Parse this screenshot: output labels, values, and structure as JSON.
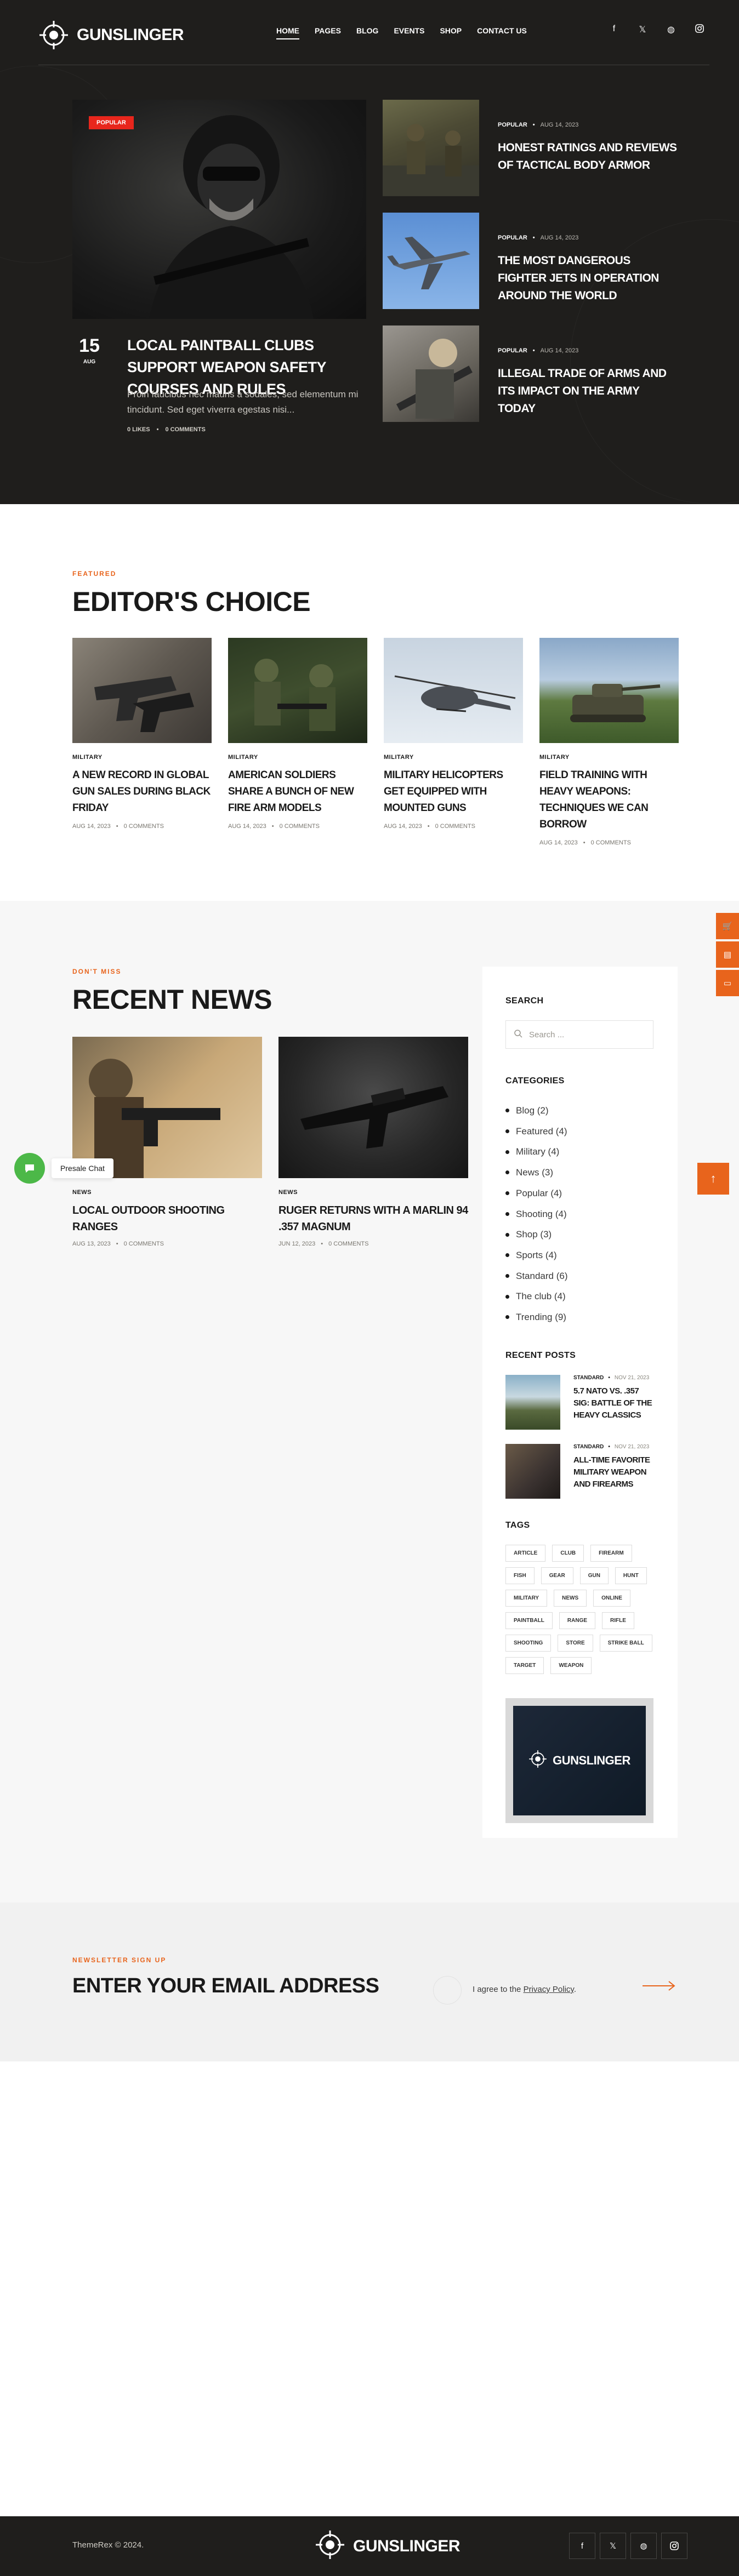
{
  "header": {
    "brand": "GUNSLINGER",
    "nav": [
      "HOME",
      "PAGES",
      "BLOG",
      "EVENTS",
      "SHOP",
      "CONTACT US"
    ],
    "social_icons": [
      "facebook-icon",
      "x-icon",
      "dribbble-icon",
      "instagram-icon"
    ]
  },
  "hero": {
    "main": {
      "badge": "POPULAR",
      "day": "15",
      "month": "AUG",
      "title": "LOCAL PAINTBALL CLUBS SUPPORT WEAPON SAFETY COURSES AND RULES",
      "excerpt": "Proin faucibus nec mauris a sodales, sed elementum mi tincidunt. Sed eget viverra egestas nisi...",
      "likes": "0 LIKES",
      "comments": "0 COMMENTS"
    },
    "side": [
      {
        "category": "POPULAR",
        "date": "AUG 14, 2023",
        "title": "HONEST RATINGS AND REVIEWS OF TACTICAL BODY ARMOR"
      },
      {
        "category": "POPULAR",
        "date": "AUG 14, 2023",
        "title": "THE MOST DANGEROUS FIGHTER JETS IN OPERATION AROUND THE WORLD"
      },
      {
        "category": "POPULAR",
        "date": "AUG 14, 2023",
        "title": "ILLEGAL TRADE OF ARMS AND ITS IMPACT ON THE ARMY TODAY"
      }
    ]
  },
  "editors": {
    "eyebrow": "FEATURED",
    "title": "EDITOR'S CHOICE",
    "cards": [
      {
        "category": "MILITARY",
        "title": "A NEW RECORD IN GLOBAL GUN SALES DURING BLACK FRIDAY",
        "date": "AUG 14, 2023",
        "comments": "0 COMMENTS"
      },
      {
        "category": "MILITARY",
        "title": "AMERICAN SOLDIERS SHARE A BUNCH OF NEW FIRE ARM MODELS",
        "date": "AUG 14, 2023",
        "comments": "0 COMMENTS"
      },
      {
        "category": "MILITARY",
        "title": "MILITARY HELICOPTERS GET EQUIPPED WITH MOUNTED GUNS",
        "date": "AUG 14, 2023",
        "comments": "0 COMMENTS"
      },
      {
        "category": "MILITARY",
        "title": "FIELD TRAINING WITH HEAVY WEAPONS: TECHNIQUES WE CAN BORROW",
        "date": "AUG 14, 2023",
        "comments": "0 COMMENTS"
      }
    ]
  },
  "recent": {
    "eyebrow": "DON'T MISS",
    "title": "RECENT NEWS",
    "cards": [
      {
        "category": "NEWS",
        "title": "LOCAL OUTDOOR SHOOTING RANGES",
        "date": "AUG 13, 2023",
        "comments": "0 COMMENTS"
      },
      {
        "category": "NEWS",
        "title": "RUGER RETURNS WITH A MARLIN 94 .357 MAGNUM",
        "date": "JUN 12, 2023",
        "comments": "0 COMMENTS"
      }
    ]
  },
  "sidebar": {
    "search_heading": "SEARCH",
    "search_placeholder": "Search ...",
    "categories_heading": "CATEGORIES",
    "categories": [
      "Blog (2)",
      "Featured (4)",
      "Military (4)",
      "News (3)",
      "Popular (4)",
      "Shooting (4)",
      "Shop (3)",
      "Sports (4)",
      "Standard (6)",
      "The club (4)",
      "Trending (9)"
    ],
    "recent_heading": "RECENT POSTS",
    "recent_posts": [
      {
        "category": "STANDARD",
        "date": "NOV 21, 2023",
        "title": "5.7 NATO VS. .357 SIG: BATTLE OF THE HEAVY CLASSICS"
      },
      {
        "category": "STANDARD",
        "date": "NOV 21, 2023",
        "title": "ALL-TIME FAVORITE MILITARY WEAPON AND FIREARMS"
      }
    ],
    "tags_heading": "TAGS",
    "tags": [
      "ARTICLE",
      "CLUB",
      "FIREARM",
      "FISH",
      "GEAR",
      "GUN",
      "HUNT",
      "MILITARY",
      "NEWS",
      "ONLINE",
      "PAINTBALL",
      "RANGE",
      "RIFLE",
      "SHOOTING",
      "STORE",
      "STRIKE BALL",
      "TARGET",
      "WEAPON"
    ],
    "banner_brand": "GUNSLINGER"
  },
  "newsletter": {
    "eyebrow": "NEWSLETTER SIGN UP",
    "title": "ENTER YOUR EMAIL ADDRESS",
    "agree_prefix": "I agree to the",
    "agree_link": "Privacy Policy",
    "agree_suffix": "."
  },
  "footer": {
    "copyright": "ThemeRex © 2024.",
    "brand": "GUNSLINGER"
  },
  "floating": {
    "chat_label": "Presale Chat"
  },
  "colors": {
    "accent": "#e8641c",
    "badge_red": "#e8261c",
    "dark_bg": "#1f1e1c",
    "chat_green": "#4cb848"
  }
}
